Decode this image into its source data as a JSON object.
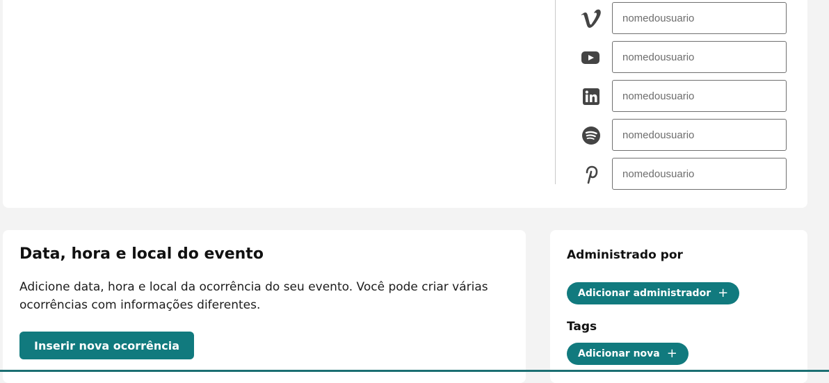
{
  "social": {
    "fields": [
      {
        "icon": "vimeo-icon",
        "placeholder": "nomedousuario"
      },
      {
        "icon": "youtube-icon",
        "placeholder": "nomedousuario"
      },
      {
        "icon": "linkedin-icon",
        "placeholder": "nomedousuario"
      },
      {
        "icon": "spotify-icon",
        "placeholder": "nomedousuario"
      },
      {
        "icon": "pinterest-icon",
        "placeholder": "nomedousuario"
      }
    ]
  },
  "event": {
    "title": "Data, hora e local do evento",
    "description": "Adicione data, hora e local da ocorrência do seu evento. Você pode criar várias ocorrências com informações diferentes.",
    "add_button": "Inserir nova ocorrência"
  },
  "admin": {
    "heading": "Administrado por",
    "add_button": "Adicionar administrador",
    "tags_heading": "Tags",
    "add_tag_button": "Adicionar nova",
    "plus_glyph": "+"
  },
  "colors": {
    "accent": "#117a7e",
    "icon": "#444444",
    "background": "#f3f3f3"
  }
}
